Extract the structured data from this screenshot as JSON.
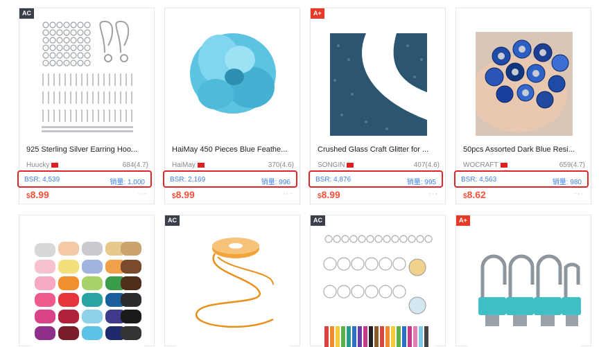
{
  "products_row1": [
    {
      "badge": "AC",
      "title": "925 Sterling Silver Earring Hoo...",
      "brand": "Huucky",
      "reviews": "684(4.7)",
      "bsr": "BSR: 4,539",
      "sales": "销量: 1,000",
      "currency": "$",
      "price": "8.99"
    },
    {
      "badge": "",
      "title": "HaiMay 450 Pieces Blue Feathe...",
      "brand": "HaiMay",
      "reviews": "370(4.6)",
      "bsr": "BSR: 2,169",
      "sales": "销量: 996",
      "currency": "$",
      "price": "8.99"
    },
    {
      "badge": "A+",
      "title": "Crushed Glass Craft Glitter for ...",
      "brand": "SONGIN",
      "reviews": "407(4.6)",
      "bsr": "BSR: 4,876",
      "sales": "销量: 995",
      "currency": "$",
      "price": "8.99"
    },
    {
      "badge": "",
      "title": "50pcs Assorted Dark Blue Resi...",
      "brand": "WOCRAFT",
      "reviews": "659(4.7)",
      "bsr": "BSR: 4,563",
      "sales": "销量: 980",
      "currency": "$",
      "price": "8.62"
    }
  ],
  "products_row2": [
    {
      "badge": ""
    },
    {
      "badge": "AC"
    },
    {
      "badge": "AC"
    },
    {
      "badge": "A+"
    }
  ],
  "more_glyph": "···",
  "colors": {
    "bsr_text": "#3f7fe6",
    "highlight_border": "#e0252a",
    "price": "#f2523b",
    "badge_ac": "#3b3f4a",
    "badge_aplus": "#e53a2a"
  }
}
